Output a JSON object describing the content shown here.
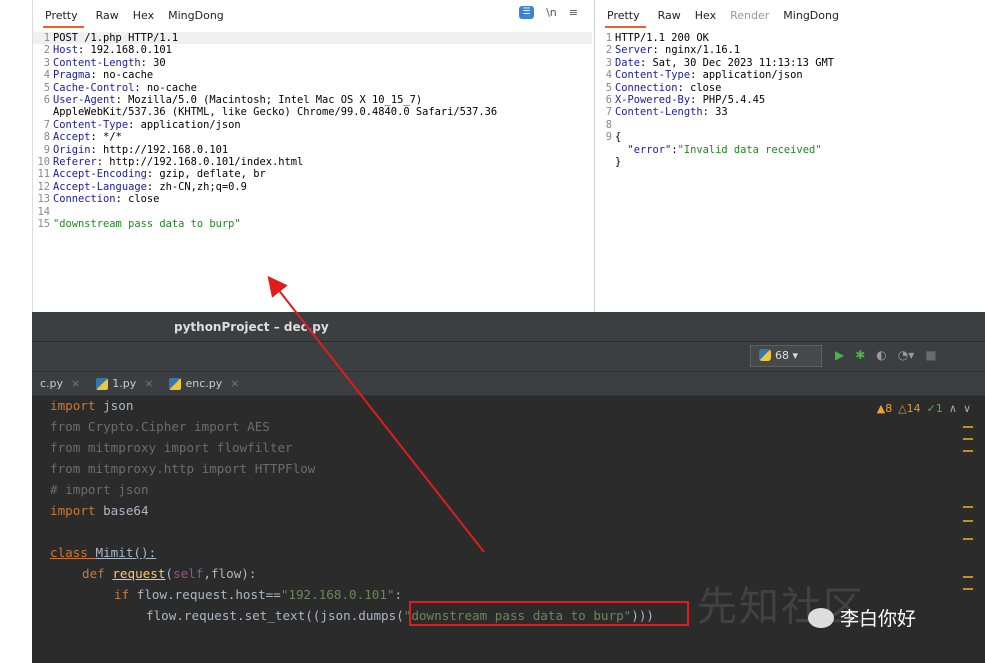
{
  "request_tabs": [
    "Pretty",
    "Raw",
    "Hex",
    "MingDong"
  ],
  "request_toolbar": [
    "\\n",
    "≡"
  ],
  "request_lines": [
    {
      "n": "1",
      "key": "",
      "val": "POST /1.php HTTP/1.1"
    },
    {
      "n": "2",
      "key": "Host",
      "val": ": 192.168.0.101"
    },
    {
      "n": "3",
      "key": "Content-Length",
      "val": ": 30"
    },
    {
      "n": "4",
      "key": "Pragma",
      "val": ": no-cache"
    },
    {
      "n": "5",
      "key": "Cache-Control",
      "val": ": no-cache"
    },
    {
      "n": "6",
      "key": "User-Agent",
      "val": ": Mozilla/5.0 (Macintosh; Intel Mac OS X 10_15_7)"
    },
    {
      "n": "",
      "key": "",
      "val": "AppleWebKit/537.36 (KHTML, like Gecko) Chrome/99.0.4840.0 Safari/537.36"
    },
    {
      "n": "7",
      "key": "Content-Type",
      "val": ": application/json"
    },
    {
      "n": "8",
      "key": "Accept",
      "val": ": */*"
    },
    {
      "n": "9",
      "key": "Origin",
      "val": ": http://192.168.0.101"
    },
    {
      "n": "10",
      "key": "Referer",
      "val": ": http://192.168.0.101/index.html"
    },
    {
      "n": "11",
      "key": "Accept-Encoding",
      "val": ": gzip, deflate, br"
    },
    {
      "n": "12",
      "key": "Accept-Language",
      "val": ": zh-CN,zh;q=0.9"
    },
    {
      "n": "13",
      "key": "Connection",
      "val": ": close"
    },
    {
      "n": "14",
      "key": "",
      "val": ""
    },
    {
      "n": "15",
      "key": "",
      "val": "\"downstream pass data to burp\"",
      "str": true
    }
  ],
  "response_tabs": [
    "Pretty",
    "Raw",
    "Hex",
    "Render",
    "MingDong"
  ],
  "response_lines": [
    {
      "n": "1",
      "key": "",
      "val": "HTTP/1.1 200 OK"
    },
    {
      "n": "2",
      "key": "Server",
      "val": ": nginx/1.16.1"
    },
    {
      "n": "3",
      "key": "Date",
      "val": ": Sat, 30 Dec 2023 11:13:13 GMT"
    },
    {
      "n": "4",
      "key": "Content-Type",
      "val": ": application/json"
    },
    {
      "n": "5",
      "key": "Connection",
      "val": ": close"
    },
    {
      "n": "6",
      "key": "X-Powered-By",
      "val": ": PHP/5.4.45"
    },
    {
      "n": "7",
      "key": "Content-Length",
      "val": ": 33"
    },
    {
      "n": "8",
      "key": "",
      "val": ""
    },
    {
      "n": "9",
      "key": "",
      "val": "{"
    },
    {
      "n": "",
      "key": "",
      "val": "  \"error\":\"Invalid data received\"",
      "json": true
    },
    {
      "n": "",
      "key": "",
      "val": "}"
    }
  ],
  "ide": {
    "title": "pythonProject – dec.py",
    "run_config": "68",
    "file_tabs": [
      {
        "name": "c.py"
      },
      {
        "name": "1.py"
      },
      {
        "name": "enc.py"
      }
    ],
    "warnings": {
      "w1": "8",
      "w2": "14",
      "ok": "1"
    },
    "code": {
      "l1a": "import ",
      "l1b": "json",
      "l2": "from Crypto.Cipher import AES",
      "l3": "from mitmproxy import flowfilter",
      "l4": "from mitmproxy.http import HTTPFlow",
      "l5": "# import json",
      "l6a": "import ",
      "l6b": "base64",
      "l7a": "class ",
      "l7b": "Mimit",
      "l7c": "():",
      "l8a": "def ",
      "l8b": "request",
      "l8c": "(",
      "l8d": "self",
      "l8e": ",flow):",
      "l9a": "if ",
      "l9b": "flow.request.host==",
      "l9c": "\"192.168.0.101\"",
      "l9d": ":",
      "l10a": "flow.request.set_text((json.dumps(",
      "l10b": "\"downstream pass data to burp\"",
      "l10c": ")))"
    }
  },
  "watermark": {
    "text": "先知社区",
    "account": "李白你好"
  }
}
